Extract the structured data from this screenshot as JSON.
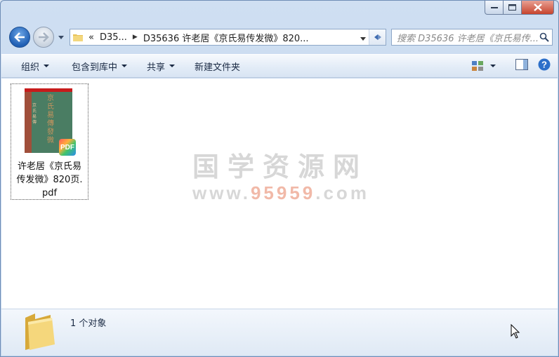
{
  "window": {
    "caption_buttons": [
      "minimize",
      "maximize",
      "close"
    ]
  },
  "nav": {
    "breadcrumb_overflow": "«",
    "breadcrumb": [
      "D35...",
      "D35636 许老居《京氏易传发微》820..."
    ],
    "search_placeholder": "搜索 D35636 许老居《京氏易传..."
  },
  "toolbar": {
    "organize": "组织",
    "include_library": "包含到库中",
    "share": "共享",
    "new_folder": "新建文件夹"
  },
  "files": [
    {
      "name_line1": "许老居《京氏易",
      "name_line2": "传发微》820页.",
      "name_line3": "pdf",
      "badge": "PDF"
    }
  ],
  "watermark": {
    "line1": "国学资源网",
    "line2_prefix": "www.",
    "line2_highlight": "95959",
    "line2_suffix": ".com"
  },
  "status": {
    "count_text": "1 个对象"
  },
  "colors": {
    "accent": "#1f5fb4",
    "close_red": "#c7442e",
    "cover_green": "#4a7d63",
    "cover_red": "#c71b1b"
  }
}
